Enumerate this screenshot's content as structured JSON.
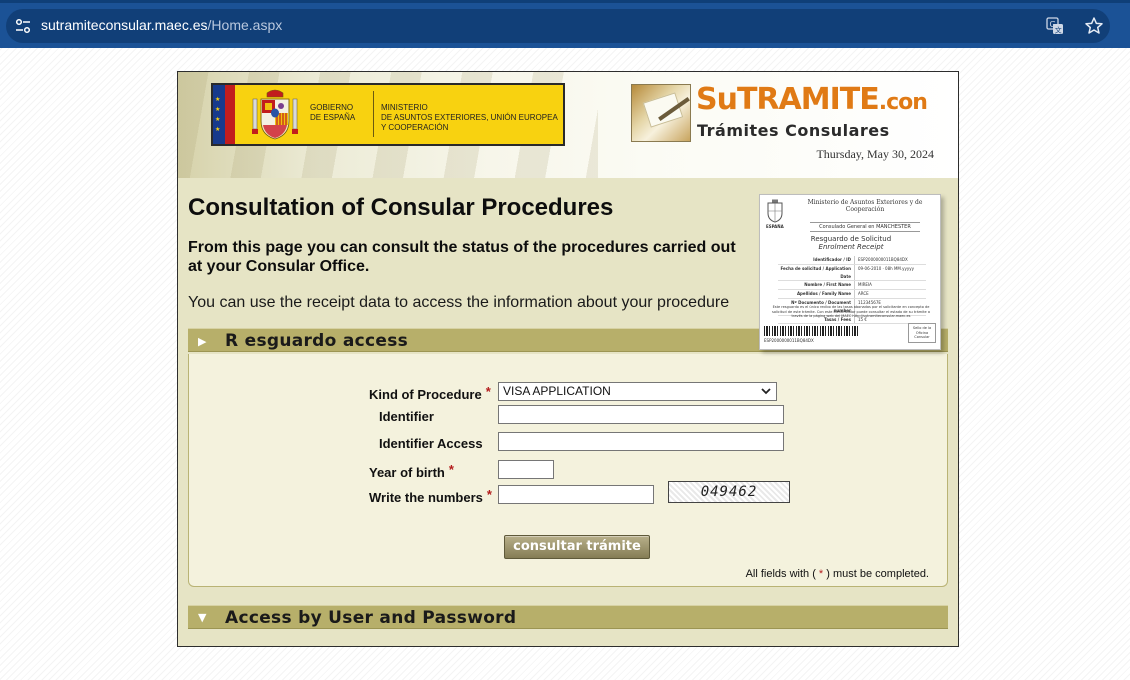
{
  "browser": {
    "url_domain": "sutramiteconsular.maec.es",
    "url_path": "/Home.aspx"
  },
  "header": {
    "gov_line1": "GOBIERNO\nDE ESPAÑA",
    "gov_line2": "MINISTERIO\nDE ASUNTOS EXTERIORES, UNIÓN EUROPEA\nY COOPERACIÓN",
    "brand_main": "SuTRAMITE",
    "brand_suffix": ".con",
    "brand_sub": "Trámites Consulares",
    "date": "Thursday, May 30, 2024"
  },
  "main": {
    "title": "Consultation of Consular Procedures",
    "intro_bold": "From this page you can consult the status of the procedures carried out at your Consular Office.",
    "intro_text": "You can use the receipt data to access the information about your procedure"
  },
  "receipt": {
    "country": "ESPAÑA",
    "ministry": "Ministerio de Asuntos Exteriores y de Cooperación",
    "consulate": "Consulado General en MANCHESTER",
    "title": "Resguardo de Solicitud",
    "subtitle": "Enrolment Receipt",
    "rows": [
      {
        "k": "Identificador / ID",
        "v": "ESP2000000011BQ84DX"
      },
      {
        "k": "Fecha de solicitud / Application Date",
        "v": "09-06-2010 · 08h MM.yyyyy"
      },
      {
        "k": "Nombre / First Name",
        "v": "MIREIA"
      },
      {
        "k": "Apellidos / Family Name",
        "v": "ARCE"
      },
      {
        "k": "Nº Documento / Document number",
        "v": "11234567E"
      },
      {
        "k": "Tasas / Fees",
        "v": "15 €"
      }
    ],
    "note": "Este resguardo es el único recibo de las tasas abonadas por el solicitante en concepto de solicitud de este trámite. Con este identificador puede consultar el estado de su trámite a través de la página web del MAEC http://sutramiteconsular.maec.es",
    "barcode_number": "ESP2000000011BQ84DX",
    "seal": "Sello de la Oficina Consular"
  },
  "section_receipt": {
    "label": "R esguardo access",
    "kind_label": "Kind of Procedure",
    "kind_value": "VISA APPLICATION",
    "identifier_label": "Identifier",
    "identifier_value": "",
    "identifier_access_label": "Identifier Access",
    "identifier_access_value": "",
    "year_label": "Year of birth",
    "year_value": "",
    "numbers_label": "Write the numbers",
    "numbers_value": "",
    "captcha": "049462",
    "required_mark": "*",
    "submit": "consultar trámite",
    "footnote_pre": "All fields with (",
    "footnote_mark": " * ",
    "footnote_post": ") must be completed."
  },
  "section_user": {
    "label": "Access by User and Password"
  },
  "colors": {
    "chrome": "#1b5296",
    "section_bar": "#b7af6a",
    "panel": "#f4f2dd",
    "brand_orange": "#e07a15",
    "required": "#b31c1c"
  }
}
